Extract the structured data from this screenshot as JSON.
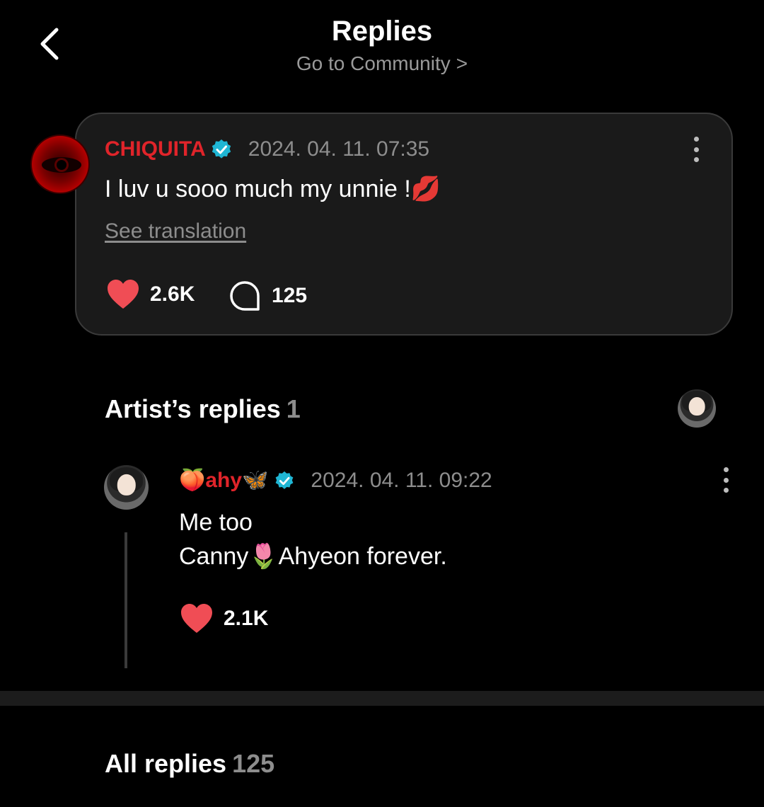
{
  "header": {
    "title": "Replies",
    "subtitle": "Go to Community",
    "subtitle_chevron": ">"
  },
  "comment": {
    "username": "CHIQUITA",
    "timestamp": "2024. 04. 11. 07:35",
    "text": "I luv u sooo much my unnie !💋",
    "see_translation": "See translation",
    "likes": "2.6K",
    "replies": "125"
  },
  "artist_section": {
    "title": "Artist’s replies",
    "count": "1"
  },
  "artist_reply": {
    "username": "🍑ahy🦋",
    "timestamp": "2024. 04. 11. 09:22",
    "line1": "Me too",
    "line2": "Canny🌷Ahyeon forever.",
    "likes": "2.1K"
  },
  "all_section": {
    "title": "All replies",
    "count": "125"
  },
  "colors": {
    "background": "#000000",
    "card": "#1a1a1a",
    "username_red": "#e0242a",
    "verified": "#1fb6d4",
    "heart": "#f04d55",
    "muted": "#8d8d8d"
  },
  "icons": [
    "back-chevron-icon",
    "verified-icon",
    "more-vertical-icon",
    "heart-icon",
    "comment-bubble-icon"
  ]
}
